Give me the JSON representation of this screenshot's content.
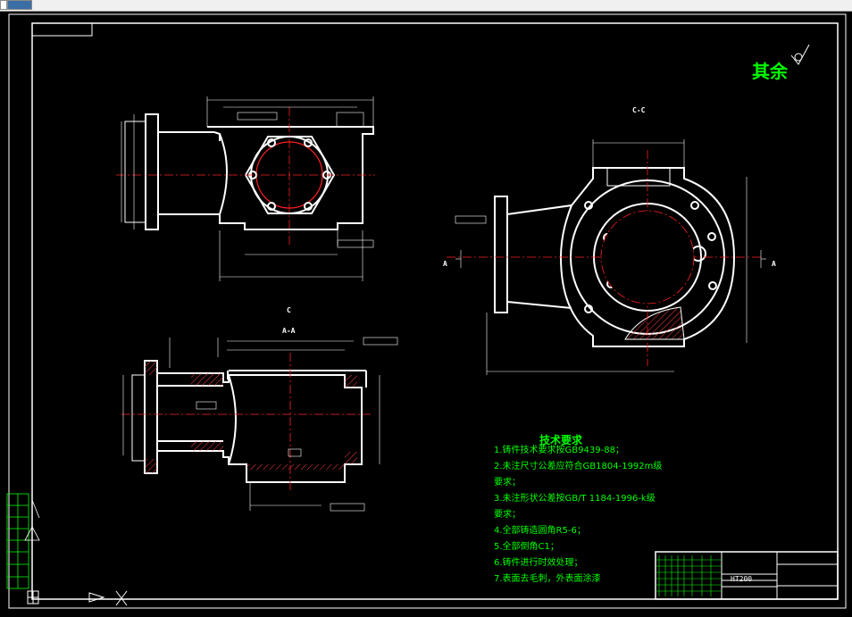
{
  "window": {
    "tabs": [
      "",
      ""
    ],
    "active_tab": 1
  },
  "drawing": {
    "roughness_label": "其余",
    "section_labels": {
      "top_view": "C",
      "section_aa": "A-A",
      "section_cc": "C-C",
      "cut_mark_left": "A",
      "cut_mark_right": "A"
    },
    "technical_requirements": {
      "title": "技术要求",
      "items": [
        "1.铸件技术要求按GB9439-88；",
        "2.未注尺寸公差应符合GB1804-1992m级",
        "要求；",
        "3.未注形状公差按GB/T 1184-1996-k级",
        "要求；",
        "4.全部铸造圆角R5-6；",
        "5.全部倒角C1；",
        "6.铸件进行时效处理；",
        "7.表面去毛刺，外表面涂漆"
      ]
    },
    "title_block": {
      "material": "HT200"
    },
    "colors": {
      "line": "#ffffff",
      "center": "#ff2020",
      "text": "#00ff00",
      "hatch": "#ff4040",
      "dimension": "#ffffff"
    },
    "icons": [
      "ucs-icon",
      "roughness-symbol-icon"
    ]
  }
}
